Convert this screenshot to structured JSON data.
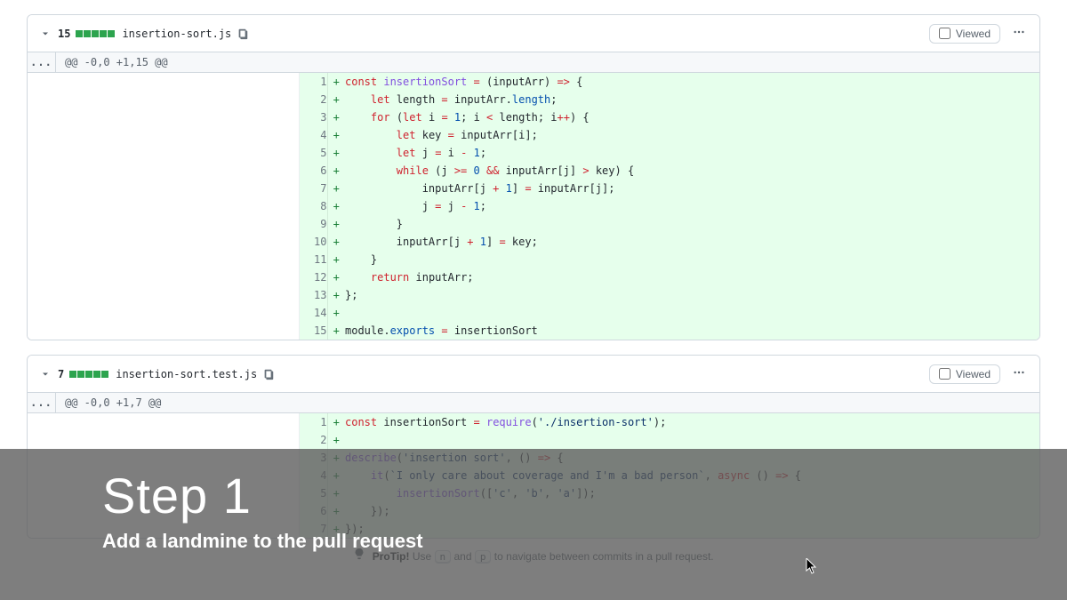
{
  "files": [
    {
      "additions": "15",
      "filename": "insertion-sort.js",
      "viewed_label": "Viewed",
      "hunk": "@@ -0,0 +1,15 @@",
      "lines": [
        {
          "n": "1",
          "html": "<span class='tok-kw'>const</span> <span class='tok-fn'>insertionSort</span> <span class='tok-op'>=</span> (<span class='tok-var'>inputArr</span>) <span class='tok-op'>=&gt;</span> {"
        },
        {
          "n": "2",
          "html": "    <span class='tok-kw'>let</span> <span class='tok-var'>length</span> <span class='tok-op'>=</span> inputArr.<span class='tok-prop'>length</span>;"
        },
        {
          "n": "3",
          "html": "    <span class='tok-kw'>for</span> (<span class='tok-kw'>let</span> <span class='tok-var'>i</span> <span class='tok-op'>=</span> <span class='tok-num'>1</span>; i <span class='tok-op'>&lt;</span> length; i<span class='tok-op'>++</span>) {"
        },
        {
          "n": "4",
          "html": "        <span class='tok-kw'>let</span> <span class='tok-var'>key</span> <span class='tok-op'>=</span> inputArr[i];"
        },
        {
          "n": "5",
          "html": "        <span class='tok-kw'>let</span> <span class='tok-var'>j</span> <span class='tok-op'>=</span> i <span class='tok-op'>-</span> <span class='tok-num'>1</span>;"
        },
        {
          "n": "6",
          "html": "        <span class='tok-kw'>while</span> (j <span class='tok-op'>&gt;=</span> <span class='tok-num'>0</span> <span class='tok-op'>&amp;&amp;</span> inputArr[j] <span class='tok-op'>&gt;</span> key) {"
        },
        {
          "n": "7",
          "html": "            inputArr[j <span class='tok-op'>+</span> <span class='tok-num'>1</span>] <span class='tok-op'>=</span> inputArr[j];"
        },
        {
          "n": "8",
          "html": "            j <span class='tok-op'>=</span> j <span class='tok-op'>-</span> <span class='tok-num'>1</span>;"
        },
        {
          "n": "9",
          "html": "        }"
        },
        {
          "n": "10",
          "html": "        inputArr[j <span class='tok-op'>+</span> <span class='tok-num'>1</span>] <span class='tok-op'>=</span> key;"
        },
        {
          "n": "11",
          "html": "    }"
        },
        {
          "n": "12",
          "html": "    <span class='tok-kw'>return</span> inputArr;"
        },
        {
          "n": "13",
          "html": "};"
        },
        {
          "n": "14",
          "html": ""
        },
        {
          "n": "15",
          "html": "module.<span class='tok-prop'>exports</span> <span class='tok-op'>=</span> insertionSort"
        }
      ]
    },
    {
      "additions": "7",
      "filename": "insertion-sort.test.js",
      "viewed_label": "Viewed",
      "hunk": "@@ -0,0 +1,7 @@",
      "lines": [
        {
          "n": "1",
          "html": "<span class='tok-kw'>const</span> <span class='tok-var'>insertionSort</span> <span class='tok-op'>=</span> <span class='tok-fn'>require</span>(<span class='tok-str'>'./insertion-sort'</span>);"
        },
        {
          "n": "2",
          "html": ""
        },
        {
          "n": "3",
          "html": "<span class='tok-fn'>describe</span>(<span class='tok-str'>'insertion sort'</span>, () <span class='tok-op'>=&gt;</span> {"
        },
        {
          "n": "4",
          "html": "    <span class='tok-fn'>it</span>(<span class='tok-str'>`I only care about coverage and I'm a bad person`</span>, <span class='tok-kw'>async</span> () <span class='tok-op'>=&gt;</span> {"
        },
        {
          "n": "5",
          "html": "        <span class='tok-fn'>insertionSort</span>([<span class='tok-str'>'c'</span>, <span class='tok-str'>'b'</span>, <span class='tok-str'>'a'</span>]);"
        },
        {
          "n": "6",
          "html": "    });"
        },
        {
          "n": "7",
          "html": "});"
        }
      ]
    }
  ],
  "overlay": {
    "title": "Step 1",
    "subtitle": "Add a landmine to the pull request"
  },
  "protip": {
    "label": "ProTip!",
    "before": " Use ",
    "key1": "n",
    "mid": " and ",
    "key2": "p",
    "after": " to navigate between commits in a pull request."
  }
}
